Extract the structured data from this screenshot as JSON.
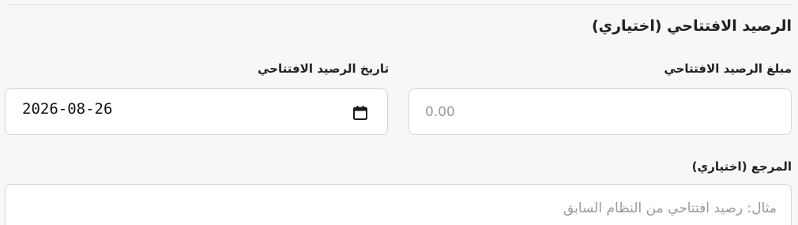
{
  "section": {
    "title": "الرصيد الافتتاحي (اختياري)"
  },
  "fields": {
    "amount": {
      "label": "مبلغ الرصيد الافتتاحي",
      "value": "",
      "placeholder": "0.00"
    },
    "date": {
      "label": "تاريخ الرصيد الافتتاحي",
      "value": "2026-08-26",
      "icon": "calendar-icon"
    },
    "reference": {
      "label": "المرجع (اختياري)",
      "value": "",
      "placeholder": "مثال: رصيد افتتاحي من النظام السابق"
    }
  }
}
